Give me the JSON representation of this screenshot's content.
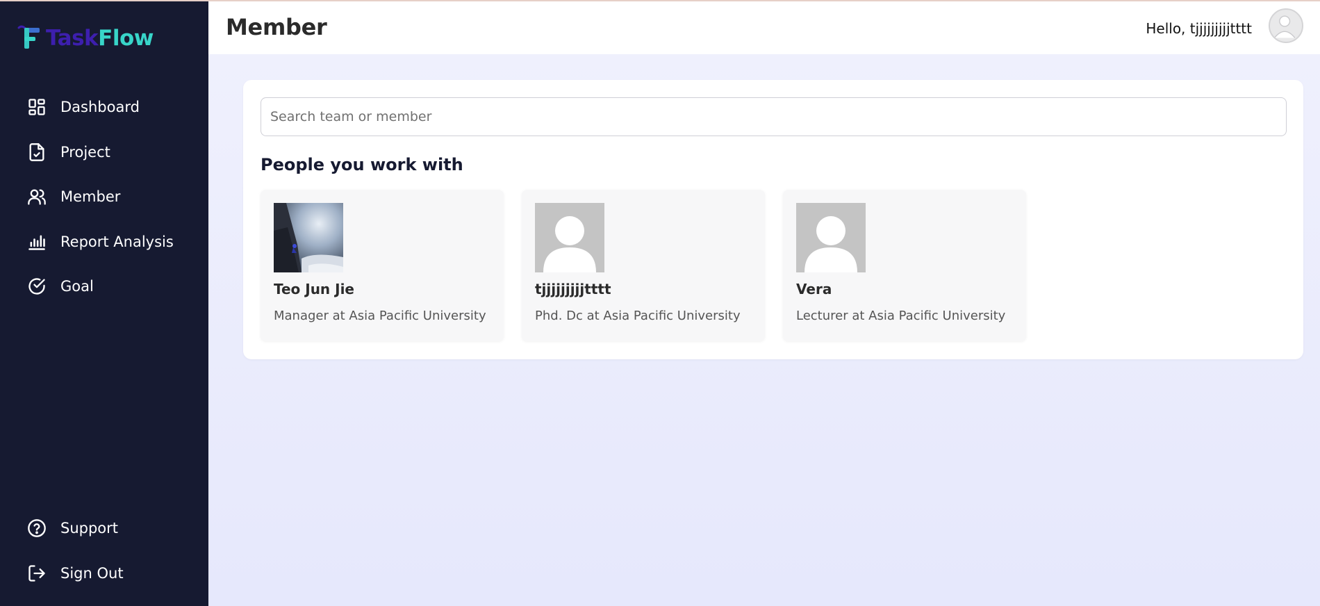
{
  "app": {
    "logo_task": "Task",
    "logo_flow": "Flow"
  },
  "sidebar": {
    "items": [
      {
        "label": "Dashboard",
        "icon": "dashboard-icon"
      },
      {
        "label": "Project",
        "icon": "document-check-icon"
      },
      {
        "label": "Member",
        "icon": "users-icon"
      },
      {
        "label": "Report Analysis",
        "icon": "bar-chart-icon"
      },
      {
        "label": "Goal",
        "icon": "check-circle-icon"
      }
    ],
    "bottom_items": [
      {
        "label": "Support",
        "icon": "help-circle-icon"
      },
      {
        "label": "Sign Out",
        "icon": "sign-out-icon"
      }
    ]
  },
  "header": {
    "title": "Member",
    "greeting": "Hello, tjjjjjjjjjtttt"
  },
  "search": {
    "placeholder": "Search team or member",
    "value": ""
  },
  "section": {
    "title": "People you work with"
  },
  "members": [
    {
      "name": "Teo Jun Jie",
      "role": "Manager at Asia Pacific University",
      "avatar": "photo"
    },
    {
      "name": "tjjjjjjjjjtttt",
      "role": "Phd. Dc at Asia Pacific University",
      "avatar": "placeholder"
    },
    {
      "name": "Vera",
      "role": "Lecturer at Asia Pacific University",
      "avatar": "placeholder"
    }
  ],
  "colors": {
    "sidebar_bg": "#161a31",
    "logo_task": "#3d1fae",
    "logo_flow": "#38d5c9",
    "main_bg": "#ecedfd",
    "card_bg": "#f7f7f8"
  }
}
